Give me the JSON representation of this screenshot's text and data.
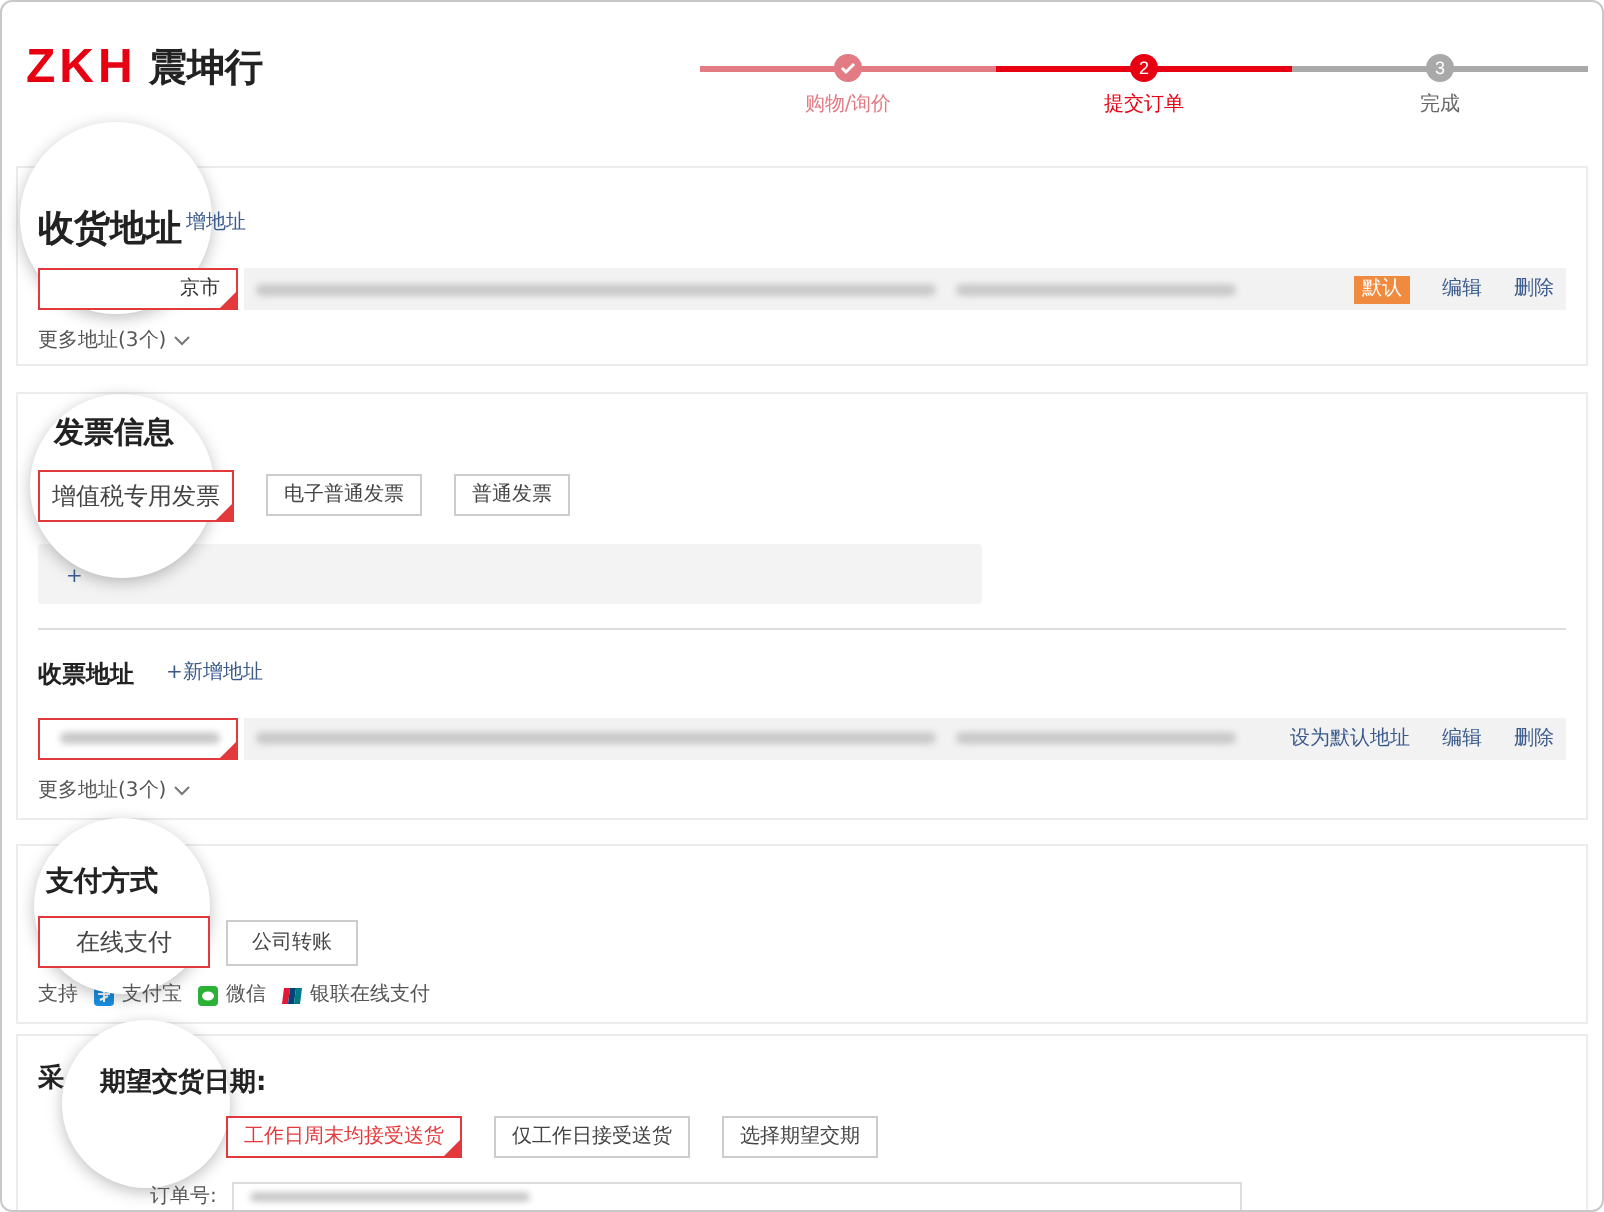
{
  "logo": {
    "brand": "ZKH",
    "name": "震坤行"
  },
  "steps": [
    {
      "label": "购物/询价",
      "completed": true,
      "selected": false
    },
    {
      "label": "提交订单",
      "number": "2",
      "completed": false,
      "selected": true
    },
    {
      "label": "完成",
      "number": "3",
      "completed": false,
      "selected": false
    }
  ],
  "shipping_address": {
    "title": "收货地址",
    "add_link": "增地址",
    "addresses": [
      {
        "tag": "京市",
        "selected": true,
        "badge": "默认",
        "actions": [
          "编辑",
          "删除"
        ]
      }
    ],
    "more": "更多地址(3个)"
  },
  "invoice": {
    "title": "发票信息",
    "types": [
      {
        "label": "增值税专用发票",
        "selected": true
      },
      {
        "label": "电子普通发票",
        "selected": false
      },
      {
        "label": "普通发票",
        "selected": false
      }
    ],
    "add_hint": "+"
  },
  "receipt_address": {
    "title": "收票地址",
    "add_link": "+新增地址",
    "addresses": [
      {
        "selected": true,
        "actions": [
          "设为默认地址",
          "编辑",
          "删除"
        ]
      }
    ],
    "more": "更多地址(3个)"
  },
  "payment": {
    "title": "支付方式",
    "methods": [
      {
        "label": "在线支付",
        "selected": true
      },
      {
        "label": "公司转账",
        "selected": false
      }
    ],
    "support_label": "支持",
    "channels": [
      {
        "kind": "alipay",
        "label": "支付宝"
      },
      {
        "kind": "wechat",
        "label": "微信"
      },
      {
        "kind": "unionpay",
        "label": "银联在线支付"
      }
    ]
  },
  "purchase": {
    "title": "采",
    "date_label": "期望交货日期:",
    "delivery_options": [
      {
        "label": "工作日周末均接受送货",
        "selected": true
      },
      {
        "label": "仅工作日接受送货",
        "selected": false
      },
      {
        "label": "选择期望交期",
        "selected": false
      }
    ],
    "order_label": "订单号:"
  }
}
